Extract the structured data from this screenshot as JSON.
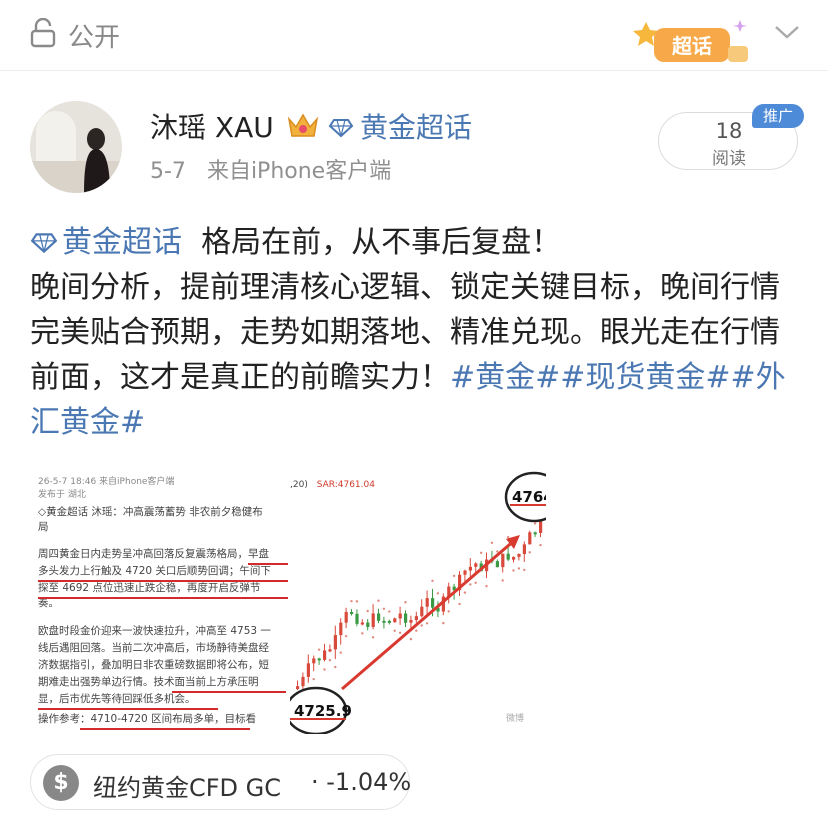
{
  "topbar": {
    "visibility_label": "公开",
    "badge_label": "超话"
  },
  "post": {
    "username": "沐瑶 XAU",
    "header_topic": "黄金超话",
    "date": "5-7",
    "source": "来自iPhone客户端",
    "read_count": "18",
    "read_label": "阅读",
    "promo_tag": "推广",
    "body_topic": "黄金超话",
    "body_text_1": "格局在前，从不事后复盘！\n晚间分析，提前理清核心逻辑、锁定关键目标，晚间行情完美贴合预期，走势如期落地、精准兑现。眼光走在行情前面，这才是真正的前瞻实力！",
    "hashtags": "#黄金##现货黄金##外汇黄金#"
  },
  "embedded_doc": {
    "timestamp": "26-5-7 18:46  来自iPhone客户端",
    "location": "发布于 湖北",
    "lines": [
      "◇黄金超话  沐瑶：冲高震荡蓄势 非农前夕稳健布",
      "局",
      "周四黄金日内走势呈冲高回落反复震荡格局，早盘",
      "多头发力上行触及 4720 关口后顺势回调；午间下",
      "探至 4692 点位迅速止跌企稳，再度开启反弹节",
      "奏。",
      "欧盘时段金价迎来一波快速拉升，冲高至 4753 一",
      "线后遇阻回落。当前二次冲高后，市场静待美盘经",
      "济数据指引，叠加明日非农重磅数据即将公布，短",
      "期难走出强势单边行情。技术面当前上方承压明",
      "显，后市优先等待回踩低多机会。",
      "操作参考：4710-4720 区间布局多单，目标看"
    ]
  },
  "embedded_chart": {
    "top_label": ",20)",
    "sar_label": "SAR:4761.04",
    "high_label": "4764",
    "low_label": "4725.9",
    "watermark": "微博"
  },
  "stock": {
    "currency_symbol": "$",
    "name": "纽约黄金CFD GC",
    "change": "· -1.04%"
  },
  "colors": {
    "link": "#4b78b3",
    "promo": "#4d8bd8",
    "up_candle": "#d84a3b",
    "down_candle": "#3a9a44",
    "sar_dots": "#e08a7f"
  }
}
